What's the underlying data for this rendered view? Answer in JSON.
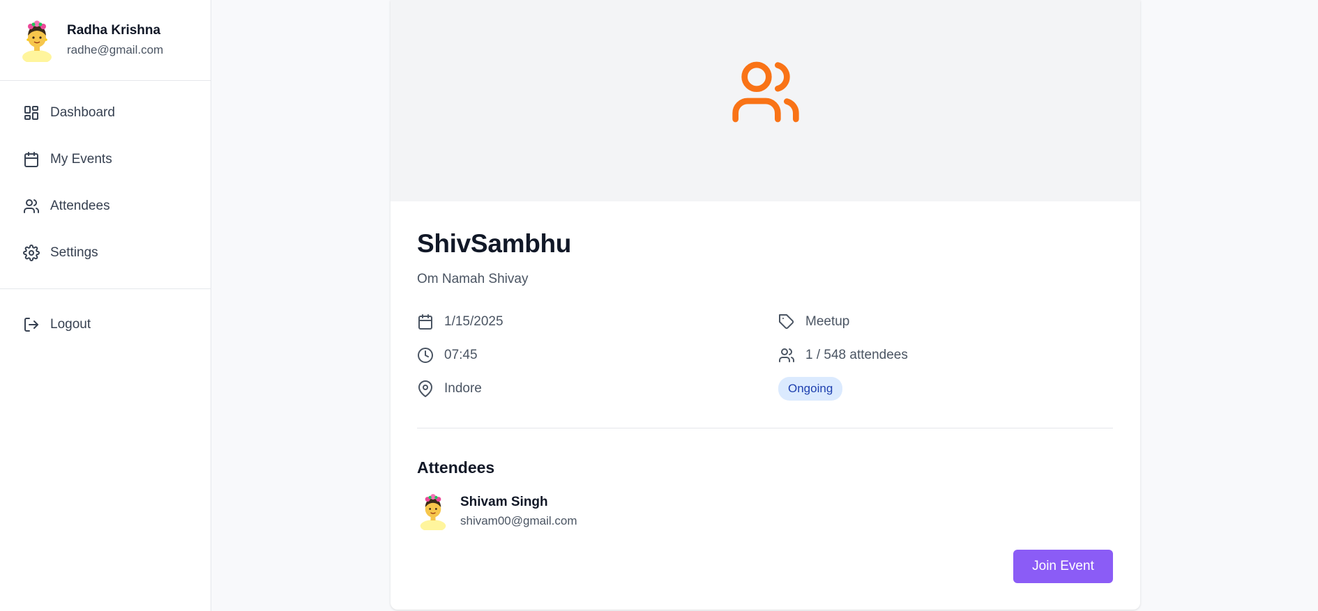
{
  "user": {
    "name": "Radha Krishna",
    "email": "radhe@gmail.com",
    "avatar": "avatar-icon"
  },
  "nav": [
    {
      "label": "Dashboard",
      "icon": "dashboard-icon"
    },
    {
      "label": "My Events",
      "icon": "calendar-icon"
    },
    {
      "label": "Attendees",
      "icon": "users-icon"
    },
    {
      "label": "Settings",
      "icon": "gear-icon"
    }
  ],
  "logout": {
    "label": "Logout",
    "icon": "logout-icon"
  },
  "event": {
    "banner_icon": "users-icon",
    "title": "ShivSambhu",
    "description": "Om Namah Shivay",
    "date": "1/15/2025",
    "time": "07:45",
    "location": "Indore",
    "category": "Meetup",
    "attendance": "1 / 548 attendees",
    "status": "Ongoing"
  },
  "attendees_section": {
    "heading": "Attendees",
    "list": [
      {
        "name": "Shivam Singh",
        "email": "shivam00@gmail.com",
        "avatar": "avatar-icon"
      }
    ]
  },
  "actions": {
    "join_label": "Join Event"
  },
  "colors": {
    "accent_orange": "#f97316",
    "button_purple": "#8b5cf6",
    "badge_bg": "#dbeafe",
    "badge_text": "#1e40af"
  }
}
